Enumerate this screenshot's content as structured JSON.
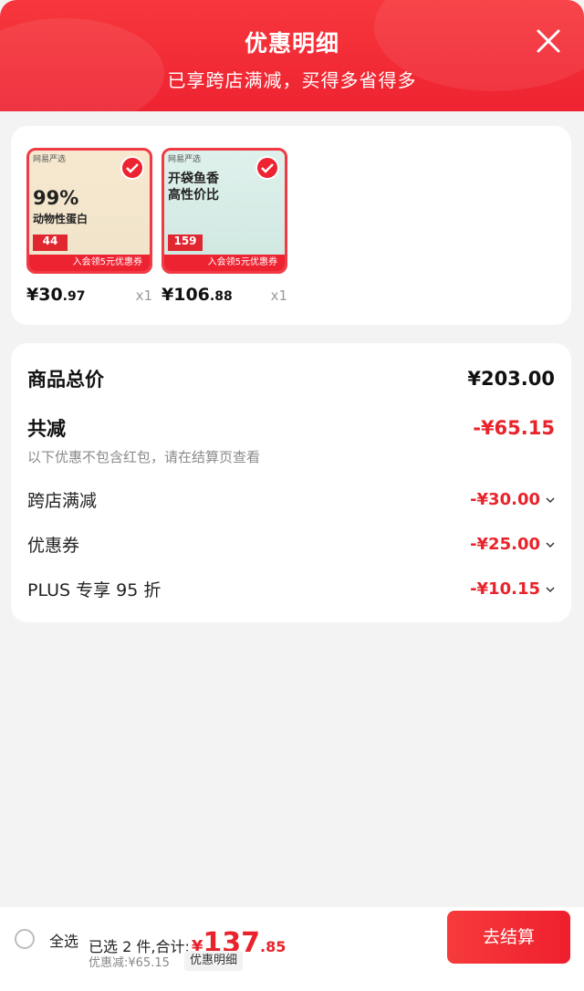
{
  "header": {
    "title": "优惠明细",
    "subtitle": "已享跨店满减，买得多省得多"
  },
  "products": [
    {
      "brand": "网易严选",
      "headline_big": "99%",
      "headline_small": "动物性蛋白",
      "tag_price": "44",
      "banner": "入会领5元优惠券",
      "price_int": "¥30",
      "price_dec": ".97",
      "qty": "x1"
    },
    {
      "brand": "网易严选",
      "headline_big": "开袋鱼香",
      "headline_small": "高性价比",
      "tag_price": "159",
      "banner": "入会领5元优惠券",
      "price_int": "¥106",
      "price_dec": ".88",
      "qty": "x1"
    }
  ],
  "summary": {
    "total_label": "商品总价",
    "total_value": "¥203.00",
    "reduce_label": "共减",
    "reduce_value": "-¥65.15",
    "note": "以下优惠不包含红包，请在结算页查看",
    "items": [
      {
        "label": "跨店满减",
        "value": "-¥30.00"
      },
      {
        "label": "优惠券",
        "value": "-¥25.00"
      },
      {
        "label": "PLUS 专享 95 折",
        "value": "-¥10.15"
      }
    ]
  },
  "bottom": {
    "select_all": "全选",
    "selected_text": "已选 2 件,合计:",
    "currency": "¥",
    "total_int": "137",
    "total_dec": ".85",
    "discount_text": "优惠减:¥65.15",
    "detail_label": "优惠明细",
    "checkout_label": "去结算"
  },
  "colors": {
    "accent": "#ee2331",
    "price_red": "#e8232b"
  }
}
